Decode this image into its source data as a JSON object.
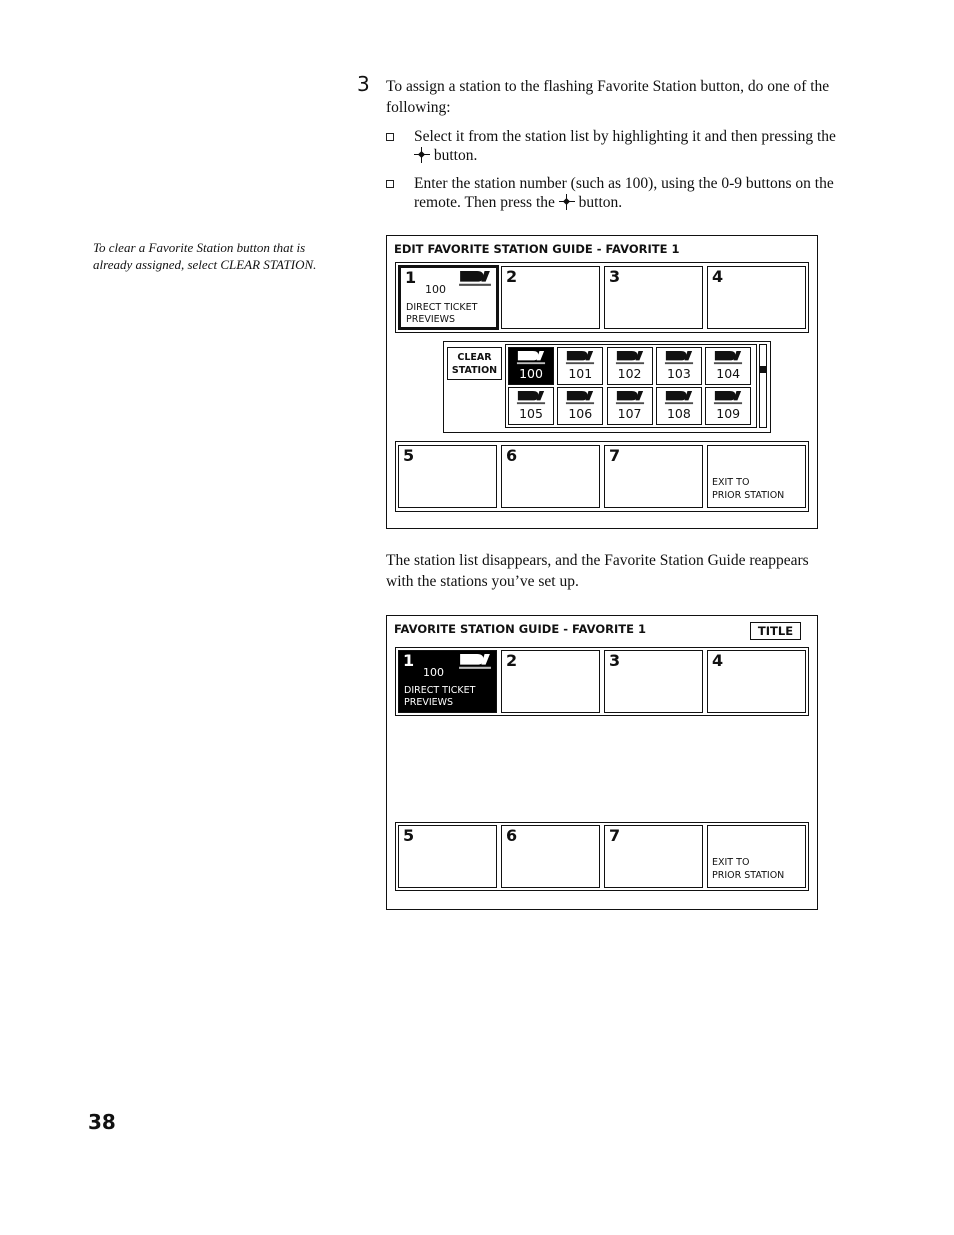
{
  "step": {
    "number": "3",
    "intro": "To assign a station to the flashing Favorite Station button, do one of the following:",
    "bullets": [
      {
        "before": "Select it from the station list by highlighting it and then pressing the",
        "after": "button.",
        "icon": "select-cross-icon"
      },
      {
        "before": "Enter the station number (such as 100), using the 0-9 buttons on the remote. Then press the",
        "after": "button.",
        "icon": "select-cross-icon"
      }
    ]
  },
  "side_note": "To clear a Favorite Station button that is already assigned, select CLEAR STATION.",
  "edit_guide": {
    "title": "EDIT FAVORITE STATION GUIDE - FAVORITE 1",
    "top_row": [
      {
        "num": "1",
        "channel": "100",
        "name_line1": "DIRECT TICKET",
        "name_line2": "PREVIEWS",
        "logo": "directv-logo-icon",
        "state": "highlighted"
      },
      {
        "num": "2"
      },
      {
        "num": "3"
      },
      {
        "num": "4"
      }
    ],
    "station_list": {
      "clear_label_line1": "CLEAR",
      "clear_label_line2": "STATION",
      "channels": [
        "100",
        "101",
        "102",
        "103",
        "104",
        "105",
        "106",
        "107",
        "108",
        "109"
      ],
      "selected": "100"
    },
    "bottom_row": [
      {
        "num": "5"
      },
      {
        "num": "6"
      },
      {
        "num": "7"
      },
      {
        "exit_line1": "EXIT TO",
        "exit_line2": "PRIOR STATION"
      }
    ]
  },
  "paragraph2": "The station list disappears, and the Favorite Station Guide reappears with the stations you’ve set up.",
  "fav_guide": {
    "title": "FAVORITE STATION GUIDE - FAVORITE 1",
    "title_button": "TITLE",
    "top_row": [
      {
        "num": "1",
        "channel": "100",
        "name_line1": "DIRECT TICKET",
        "name_line2": "PREVIEWS",
        "logo": "directv-logo-icon",
        "state": "selected"
      },
      {
        "num": "2"
      },
      {
        "num": "3"
      },
      {
        "num": "4"
      }
    ],
    "bottom_row": [
      {
        "num": "5"
      },
      {
        "num": "6"
      },
      {
        "num": "7"
      },
      {
        "exit_line1": "EXIT TO",
        "exit_line2": "PRIOR STATION"
      }
    ]
  },
  "page_number": "38"
}
